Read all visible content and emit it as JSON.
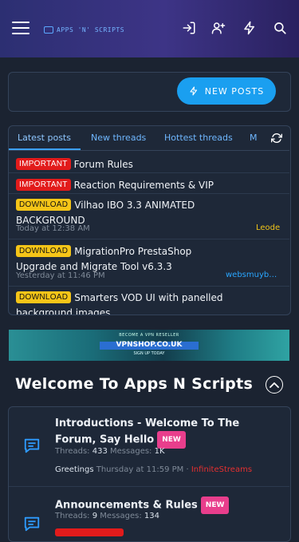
{
  "header": {
    "logo_text": "APPS 'N' SCRIPTS",
    "icons": [
      "menu-icon",
      "login-icon",
      "register-icon",
      "lightning-icon",
      "search-icon"
    ]
  },
  "new_posts_button": {
    "label": "NEW POSTS"
  },
  "tabs": [
    {
      "label": "Latest posts",
      "active": true
    },
    {
      "label": "New threads"
    },
    {
      "label": "Hottest threads"
    },
    {
      "label": "M"
    }
  ],
  "latest": [
    {
      "badge": "IMPORTANT",
      "badge_color": "#e21b1b",
      "title": "Forum Rules"
    },
    {
      "badge": "IMPORTANT",
      "badge_color": "#e21b1b",
      "title": "Reaction Requirements & VIP"
    },
    {
      "badge": "DOWNLOAD",
      "badge_color": "#f5c518",
      "title": "Vilhao IBO 3.3 ANIMATED",
      "title2": "BACKGROUND",
      "time": "Today at 12:38 AM",
      "user": "Leode",
      "user_color": "#f0c419"
    },
    {
      "badge": "DOWNLOAD",
      "badge_color": "#f5c518",
      "title": "MigrationPro PrestaShop",
      "title2": "Upgrade and Migrate Tool v6.3.3",
      "time": "Yesterday at 11:46 PM",
      "user": "websmuyb…",
      "user_color": "#2aa6ff"
    },
    {
      "badge": "DOWNLOAD",
      "badge_color": "#f5c518",
      "title": "Smarters VOD UI with panelled",
      "title2": "background images"
    }
  ],
  "banner": {
    "line1": "BECOME A VPN RESELLER",
    "line2": "VPNSHOP.CO.UK",
    "line3": "SIGN UP TODAY"
  },
  "section": {
    "title": "Welcome To Apps N Scripts"
  },
  "forums": [
    {
      "title_line1": "Introductions - Welcome To The",
      "title_line2": "Forum, Say Hello",
      "new_label": "NEW",
      "threads_label": "Threads:",
      "threads": "433",
      "messages_label": "Messages:",
      "messages": "1K",
      "latest_thread": "Greetings",
      "latest_time": "Thursday at 11:59 PM",
      "latest_sep": "·",
      "latest_user": "InfiniteStreams"
    },
    {
      "title_line1": "Announcements & Rules",
      "new_label": "NEW",
      "threads_label": "Threads:",
      "threads": "9",
      "messages_label": "Messages:",
      "messages": "134"
    }
  ]
}
